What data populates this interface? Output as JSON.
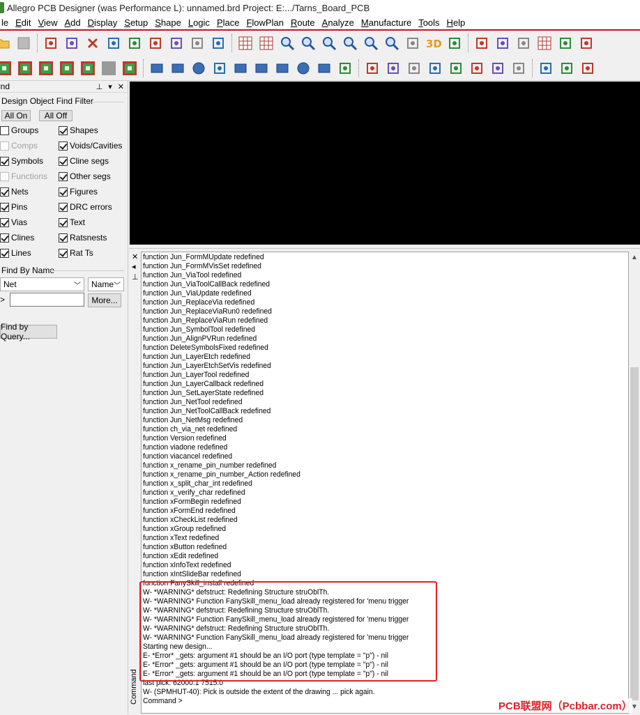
{
  "window": {
    "title": "Allegro PCB Designer (was Performance L): unnamed.brd  Project: E:.../Tarns_Board_PCB"
  },
  "menu": [
    {
      "label": "File",
      "visible": "le"
    },
    {
      "label": "Edit"
    },
    {
      "label": "View"
    },
    {
      "label": "Add"
    },
    {
      "label": "Display"
    },
    {
      "label": "Setup"
    },
    {
      "label": "Shape"
    },
    {
      "label": "Logic"
    },
    {
      "label": "Place"
    },
    {
      "label": "FlowPlan"
    },
    {
      "label": "Route"
    },
    {
      "label": "Analyze"
    },
    {
      "label": "Manufacture"
    },
    {
      "label": "Tools"
    },
    {
      "label": "Help"
    }
  ],
  "toolbar_icons": {
    "row1": [
      "open-folder-icon",
      "save-icon",
      "move-icon",
      "copy-icon",
      "delete-icon",
      "undo-icon",
      "redo-icon",
      "down-icon",
      "down2-icon",
      "pin-green-icon",
      "pushpin-icon",
      "grid-icon",
      "grid2-icon",
      "zoom-fit-icon",
      "zoom-in-icon",
      "zoom-out-icon",
      "zoom-prev-icon",
      "zoom-world-icon",
      "zoom-center-icon",
      "refresh-icon",
      "3d-view-icon",
      "flip-icon",
      "layer-icon",
      "component-icon",
      "pin-icon",
      "grid-dots-icon",
      "color-icon",
      "settings-icon"
    ],
    "row2": [
      "green-sq1-icon",
      "green-sq2-icon",
      "green-sq3-icon",
      "green-sq4-icon",
      "green-sq5-icon",
      "gray-sq-icon",
      "green-sq6-icon",
      "shape-corner-icon",
      "shape-rect-icon",
      "shape-circle-icon",
      "select-icon",
      "shape-poly-icon",
      "shape-void-icon",
      "rect-outline-icon",
      "circle-outline-icon",
      "shape-edit-icon",
      "merge-icon",
      "route-icon",
      "fanout-icon",
      "slide-icon",
      "delay-icon",
      "bus-icon",
      "bundle-icon",
      "differential-icon",
      "tune-icon",
      "component-green-icon",
      "measure-icon",
      "dimension-icon"
    ]
  },
  "find_panel": {
    "title": "Find",
    "title_visible": "ind",
    "filter_title": "Design Object Find Filter",
    "all_on": "All On",
    "all_off": "All Off",
    "checkboxes_left": [
      {
        "label": "Groups",
        "checked": false,
        "enabled": true
      },
      {
        "label": "Comps",
        "checked": false,
        "enabled": false
      },
      {
        "label": "Symbols",
        "checked": true,
        "enabled": true
      },
      {
        "label": "Functions",
        "checked": false,
        "enabled": false
      },
      {
        "label": "Nets",
        "checked": true,
        "enabled": true
      },
      {
        "label": "Pins",
        "checked": true,
        "enabled": true
      },
      {
        "label": "Vias",
        "checked": true,
        "enabled": true
      },
      {
        "label": "Clines",
        "checked": true,
        "enabled": true
      },
      {
        "label": "Lines",
        "checked": true,
        "enabled": true
      }
    ],
    "checkboxes_right": [
      {
        "label": "Shapes",
        "checked": true
      },
      {
        "label": "Voids/Cavities",
        "checked": true
      },
      {
        "label": "Cline segs",
        "checked": true
      },
      {
        "label": "Other segs",
        "checked": true
      },
      {
        "label": "Figures",
        "checked": true
      },
      {
        "label": "DRC errors",
        "checked": true
      },
      {
        "label": "Text",
        "checked": true
      },
      {
        "label": "Ratsnests",
        "checked": true
      },
      {
        "label": "Rat Ts",
        "checked": true
      }
    ],
    "find_by_name": "Find By Name",
    "type_select": "Net",
    "mode_select": "Name",
    "prompt": ">",
    "name_input_value": "",
    "more_button": "More...",
    "find_by_query": "Find by Query..."
  },
  "command": {
    "side_label": "Command",
    "lines": [
      "function Jun_FormMUpdate redefined",
      "function Jun_FormMVisSet redefined",
      "function Jun_ViaTool redefined",
      "function Jun_ViaToolCallBack redefined",
      "function Jun_ViaUpdate redefined",
      "function Jun_ReplaceVia redefined",
      "function Jun_ReplaceViaRun0 redefined",
      "function Jun_ReplaceViaRun redefined",
      "function Jun_SymbolTool redefined",
      "function Jun_AlignPVRun redefined",
      "function DeleteSymbolsFixed redefined",
      "function Jun_LayerEtch redefined",
      "function Jun_LayerEtchSetVis redefined",
      "function Jun_LayerTool redefined",
      "function Jun_LayerCallback redefined",
      "function Jun_SetLayerState redefined",
      "function Jun_NetTool redefined",
      "function Jun_NetToolCallBack redefined",
      "function Jun_NetMsg redefined",
      "function ch_via_net redefined",
      "function Version redefined",
      "function viadone redefined",
      "function viacancel redefined",
      "function x_rename_pin_number redefined",
      "function x_rename_pin_number_Action redefined",
      "function x_split_char_int redefined",
      "function x_verify_char redefined",
      "function xFormBegin redefined",
      "function xFormEnd redefined",
      "function xCheckList redefined",
      "function xGroup redefined",
      "function xText redefined",
      "function xButton redefined",
      "function xEdit redefined",
      "function xInfoText redefined",
      "function xIntSlideBar redefined",
      "function FanySkill_install redefined",
      "W- *WARNING* defstruct: Redefining Structure struOblTh.",
      "W- *WARNING* Function FanySkill_menu_load already registered for 'menu trigger",
      "W- *WARNING* defstruct: Redefining Structure struOblTh.",
      "W- *WARNING* Function FanySkill_menu_load already registered for 'menu trigger",
      "W- *WARNING* defstruct: Redefining Structure struOblTh.",
      "W- *WARNING* Function FanySkill_menu_load already registered for 'menu trigger",
      "Starting new design...",
      "E- *Error* _gets: argument #1 should be an I/O port (type template = \"p\") - nil",
      "E- *Error* _gets: argument #1 should be an I/O port (type template = \"p\") - nil",
      "E- *Error* _gets: argument #1 should be an I/O port (type template = \"p\") - nil",
      "last pick:  62000.1 7515.0",
      "W- (SPMHUT-40): Pick is outside the extent of the drawing ... pick again.",
      "Command >"
    ]
  },
  "colors": {
    "highlight": "#e0202a",
    "canvas": "#000000"
  },
  "watermark": "PCB联盟网（Pcbbar.com）"
}
